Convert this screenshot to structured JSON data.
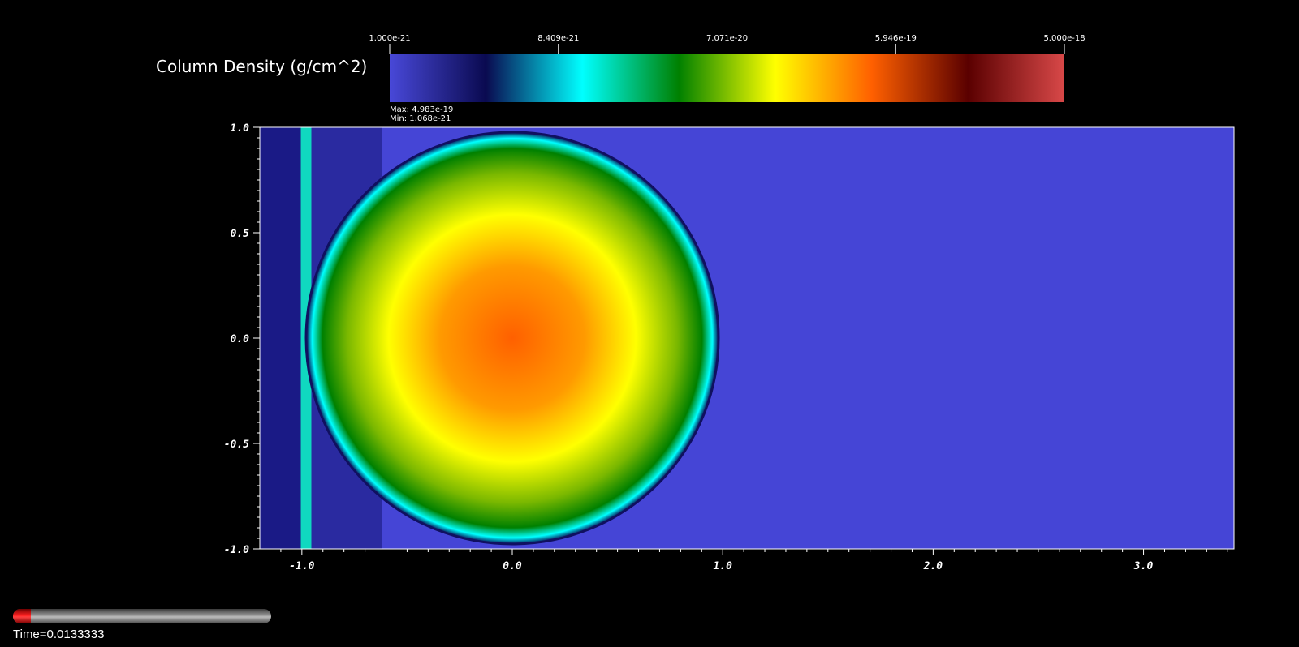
{
  "legend": {
    "title": "Column Density (g/cm^2)",
    "ticks": [
      "1.000e-21",
      "8.409e-21",
      "7.071e-20",
      "5.946e-19",
      "5.000e-18"
    ],
    "max_text": "Max:  4.983e-19",
    "min_text": "Min:  1.068e-21",
    "colormap": [
      "#4848d8",
      "#0a0a50",
      "#00ffff",
      "#008000",
      "#ffff00",
      "#ff6000",
      "#5a0000",
      "#d84848"
    ]
  },
  "time_label": "Time=0.0133333",
  "time_slider": {
    "progress": 0.07
  },
  "chart_data": {
    "type": "heatmap",
    "xlim": [
      -1.2,
      3.43
    ],
    "ylim": [
      -1.0,
      1.0
    ],
    "x_ticks": [
      "-1.0",
      "0.0",
      "1.0",
      "2.0",
      "3.0"
    ],
    "y_ticks": [
      "1.0",
      "0.5",
      "0.0",
      "-0.5",
      "-1.0"
    ],
    "background_value": 1e-21,
    "sphere": {
      "center": [
        0.0,
        0.0
      ],
      "radius": 0.98,
      "peak_value": 4.983e-19
    },
    "shock_layer": {
      "x": -0.98,
      "halfwidth": 0.025
    },
    "upstream_band": {
      "x_from": -1.2,
      "x_to": -0.62
    }
  }
}
